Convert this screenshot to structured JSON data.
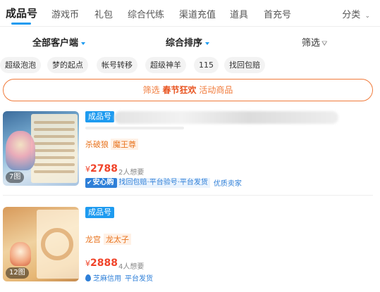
{
  "tabs": {
    "items": [
      "成品号",
      "游戏币",
      "礼包",
      "综合代练",
      "渠道充值",
      "道具",
      "首充号"
    ],
    "more_label": "分类"
  },
  "sort": {
    "client_label": "全部客户端",
    "order_label": "综合排序",
    "filter_label": "筛选"
  },
  "tags": [
    "超级泡泡",
    "梦的起点",
    "帐号转移",
    "超级神羊",
    "115",
    "找回包赔"
  ],
  "banner": {
    "prefix": "筛选",
    "highlight": "春节狂欢",
    "suffix": "活动商品"
  },
  "listings": [
    {
      "image_count": "7图",
      "badge": "成品号",
      "attrs": [
        "杀破狼",
        "魔王尊"
      ],
      "currency": "¥",
      "price": "2788",
      "want": "2人想要",
      "safe_badge": "安心购",
      "safe_detail": "找回包赔·平台验号·平台发货",
      "quality": "优质卖家"
    },
    {
      "image_count": "12图",
      "badge": "成品号",
      "attrs": [
        "龙宫",
        "龙太子"
      ],
      "currency": "¥",
      "price": "2888",
      "want": "4人想要",
      "credit": "芝麻信用",
      "credit_detail": "平台发货"
    }
  ],
  "colors": {
    "accent_blue": "#1e9bf0",
    "orange": "#f07a3a",
    "price_red": "#f0442a"
  }
}
